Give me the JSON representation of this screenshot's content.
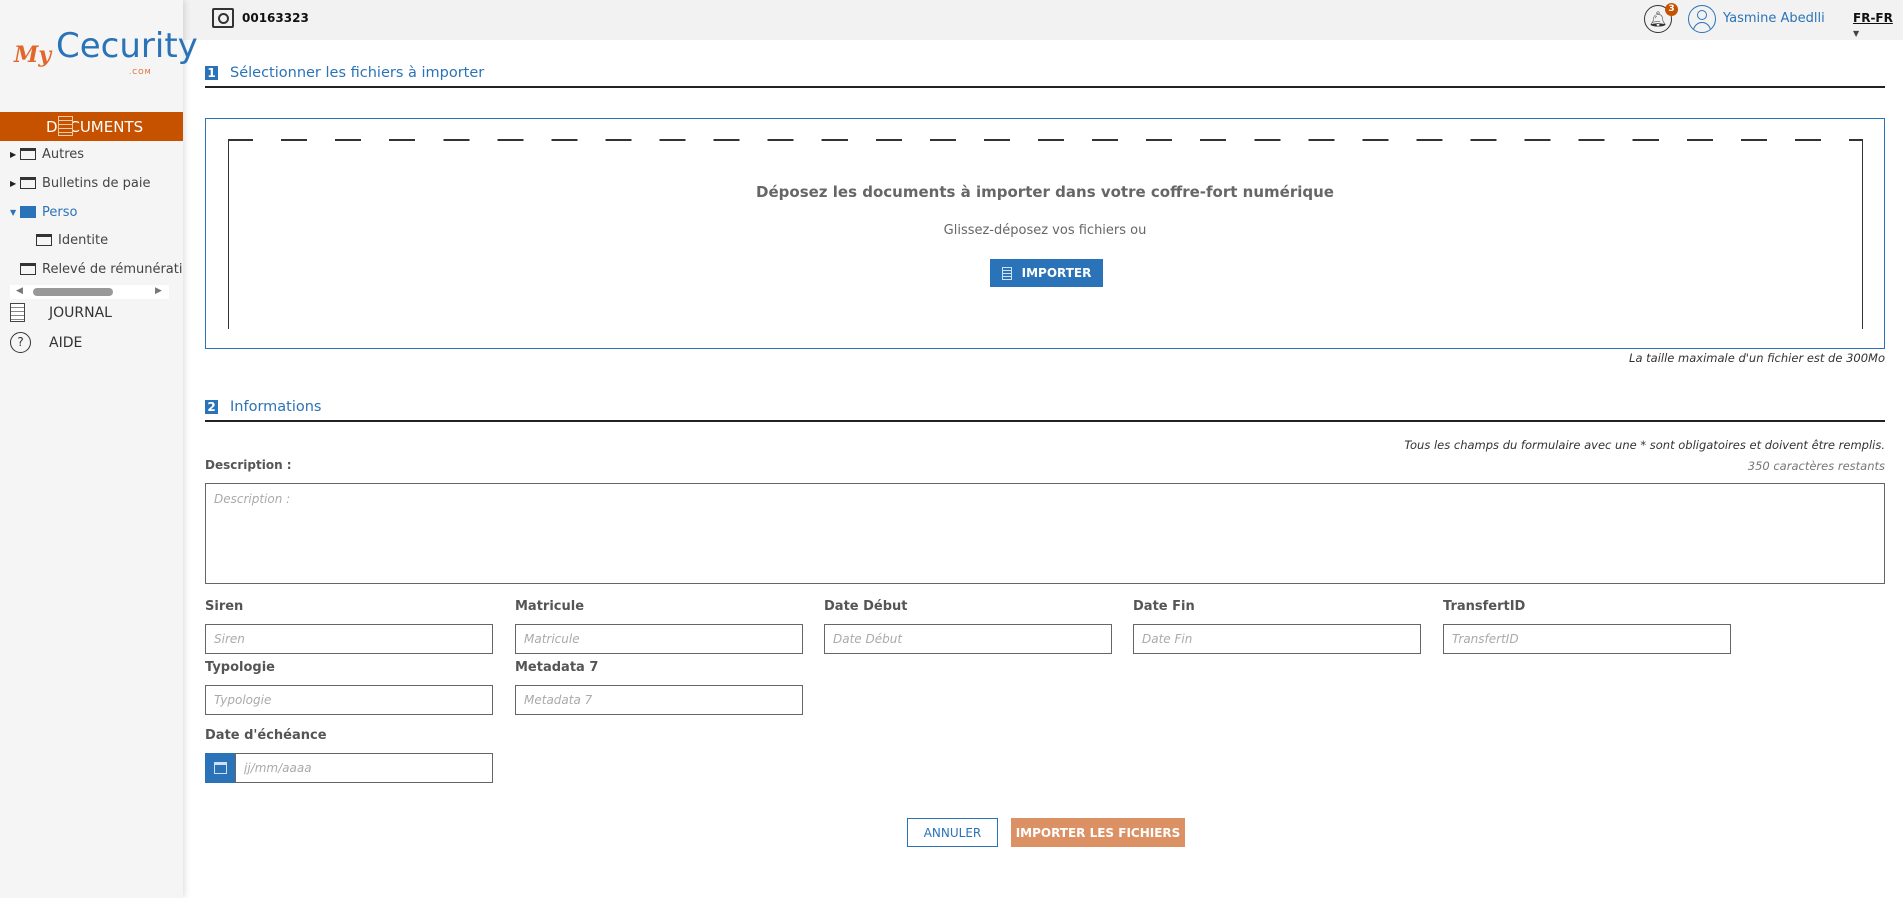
{
  "header": {
    "account_id": "00163323",
    "notification_count": "3",
    "user_name": "Yasmine Abedlli",
    "language": "FR-FR"
  },
  "sidebar": {
    "logo_text": "MyCecurity.com",
    "documents_label": "DOCUMENTS",
    "tree": [
      {
        "label": "Autres"
      },
      {
        "label": "Bulletins de paie"
      },
      {
        "label": "Perso"
      },
      {
        "label": "Identite"
      },
      {
        "label": "Relevé de rémunérati"
      }
    ],
    "journal_label": "JOURNAL",
    "aide_label": "AIDE"
  },
  "section1": {
    "number": "1",
    "title": "Sélectionner les fichiers à importer",
    "drop_title": "Déposez les documents à importer dans votre coffre-fort numérique",
    "drop_subtitle": "Glissez-déposez vos fichiers ou",
    "import_button": "IMPORTER",
    "max_size": "La taille maximale d'un fichier est de 300Mo"
  },
  "section2": {
    "number": "2",
    "title": "Informations",
    "required_note": "Tous les champs du formulaire avec une * sont obligatoires et doivent être remplis.",
    "description_label": "Description :",
    "description_placeholder": "Description :",
    "chars_remaining": "350 caractères restants",
    "fields": [
      {
        "label": "Siren",
        "placeholder": "Siren"
      },
      {
        "label": "Matricule",
        "placeholder": "Matricule"
      },
      {
        "label": "Date Début",
        "placeholder": "Date Début"
      },
      {
        "label": "Date Fin",
        "placeholder": "Date Fin"
      },
      {
        "label": "TransfertID",
        "placeholder": "TransfertID"
      },
      {
        "label": "Typologie",
        "placeholder": "Typologie"
      },
      {
        "label": "Metadata 7",
        "placeholder": "Metadata 7"
      }
    ],
    "due_date": {
      "label": "Date d'échéance",
      "placeholder": "jj/mm/aaaa"
    }
  },
  "actions": {
    "cancel": "ANNULER",
    "submit": "IMPORTER LES FICHIERS"
  },
  "colors": {
    "brand_orange": "#c65200",
    "accent_blue": "#2a73b8",
    "submit_bg": "#dc9165"
  }
}
